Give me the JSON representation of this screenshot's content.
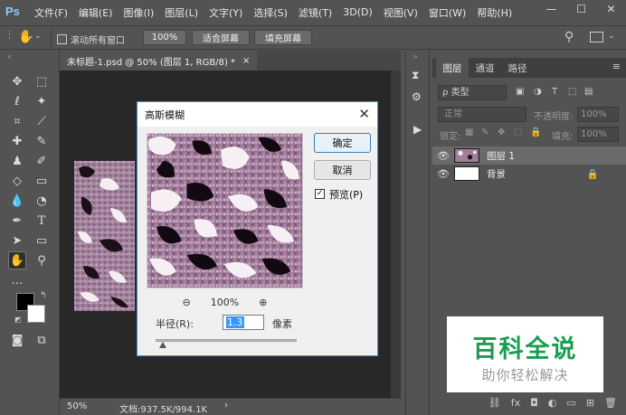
{
  "app": {
    "logo": "Ps"
  },
  "menu": [
    "文件(F)",
    "编辑(E)",
    "图像(I)",
    "图层(L)",
    "文字(Y)",
    "选择(S)",
    "滤镜(T)",
    "3D(D)",
    "视图(V)",
    "窗口(W)",
    "帮助(H)"
  ],
  "window_controls": {
    "minimize": "—",
    "maximize": "☐",
    "close": "✕"
  },
  "options_bar": {
    "scroll_all_label": "滚动所有窗口",
    "zoom_100": "100%",
    "fit_screen": "适合屏幕",
    "fill_screen": "填充屏幕"
  },
  "document": {
    "tab_label": "未标题-1.psd @ 50% (图层 1, RGB/8) *",
    "tab_close": "×",
    "zoom": "50%",
    "doc_size": "文档:937.5K/994.1K"
  },
  "dialog": {
    "title": "高斯模糊",
    "close": "✕",
    "ok": "确定",
    "cancel": "取消",
    "preview_label": "预览(P)",
    "preview_checked": true,
    "zoom_level": "100%",
    "zoom_out": "⊖",
    "zoom_in": "⊕",
    "radius_label": "半径(R):",
    "radius_value": "1.3",
    "radius_unit": "像素",
    "slider_position": 0.05
  },
  "layers_panel": {
    "tabs": [
      "图层",
      "通道",
      "路径"
    ],
    "active_tab": 0,
    "filter_type": "ρ 类型",
    "blend_mode": "正常",
    "opacity_label": "不透明度:",
    "opacity_value": "100%",
    "lock_label": "锁定:",
    "fill_label": "填充:",
    "fill_value": "100%",
    "layers": [
      {
        "name": "图层 1",
        "visible": true,
        "selected": true
      },
      {
        "name": "背景",
        "visible": true,
        "selected": false,
        "locked": true
      }
    ]
  },
  "watermark": {
    "title": "百科全说",
    "subtitle": "助你轻松解决"
  },
  "colors": {
    "foreground": "#000000",
    "background": "#ffffff",
    "accent": "#4a90d9",
    "watermark_green": "#1a9d4f"
  }
}
